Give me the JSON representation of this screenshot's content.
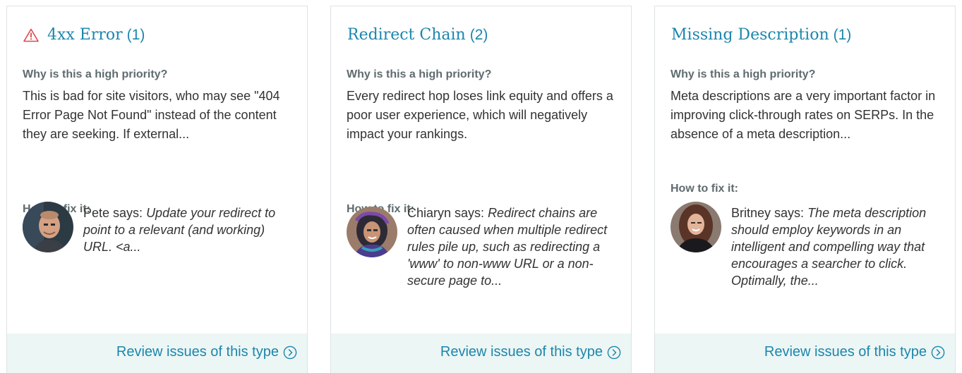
{
  "cards": [
    {
      "title": "4xx Error",
      "count": "(1)",
      "has_warning_icon": true,
      "why_label": "Why is this a high priority?",
      "why_text": "This is bad for site visitors, who may see \"404 Error Page Not Found\" instead of the content they are seeking. If external...",
      "fix_label": "How to fix it:",
      "expert_says": "Pete says:",
      "advice": "Update your redirect to point to a relevant (and working) URL. <a...",
      "avatar": "pete-avatar",
      "review_label": "Review issues of this type",
      "review_icon": "chevron-right-circle-icon"
    },
    {
      "title": "Redirect Chain",
      "count": "(2)",
      "has_warning_icon": false,
      "why_label": "Why is this a high priority?",
      "why_text": "Every redirect hop loses link equity and offers a poor user experience, which will negatively impact your rankings.",
      "fix_label": "How to fix it:",
      "expert_says": "Chiaryn says:",
      "advice": "Redirect chains are often caused when multiple redirect rules pile up, such as redirecting a 'www' to non-www URL or a non-secure page to...",
      "avatar": "chiaryn-avatar",
      "review_label": "Review issues of this type",
      "review_icon": "chevron-right-circle-icon"
    },
    {
      "title": "Missing Description",
      "count": "(1)",
      "has_warning_icon": false,
      "why_label": "Why is this a high priority?",
      "why_text": "Meta descriptions are a very important factor in improving click-through rates on SERPs. In the absence of a meta description...",
      "fix_label": "How to fix it:",
      "expert_says": "Britney says:",
      "advice": "The meta description should employ keywords in an intelligent and compelling way that encourages a searcher to click. Optimally, the...",
      "avatar": "britney-avatar",
      "review_label": "Review issues of this type",
      "review_icon": "chevron-right-circle-icon"
    }
  ],
  "colors": {
    "accent": "#1c86ac",
    "warning": "#e0464b",
    "footer_bg": "#ecf6f5",
    "border": "#dde3e5"
  }
}
